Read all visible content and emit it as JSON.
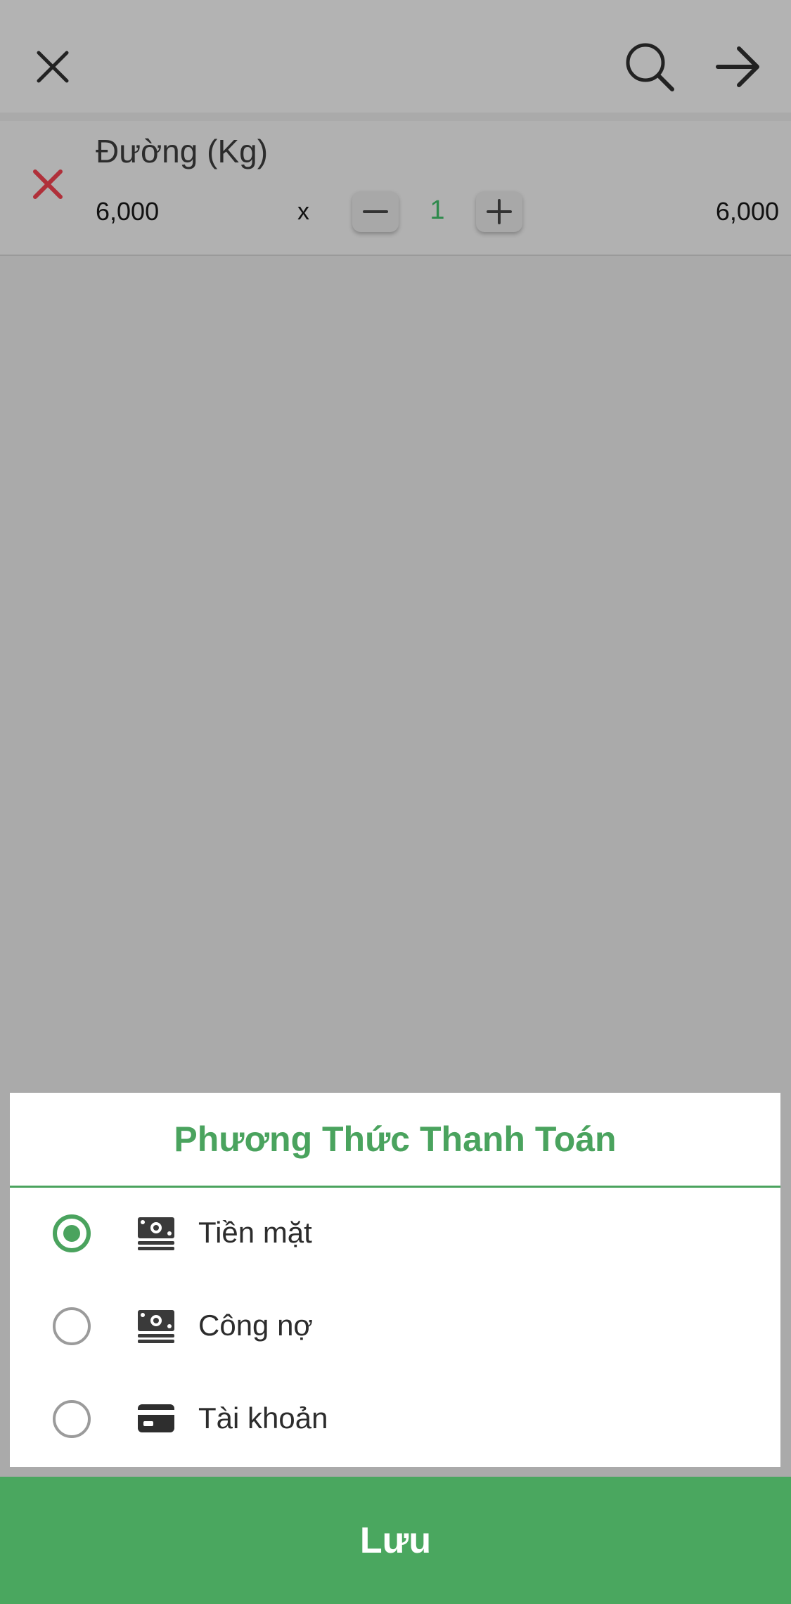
{
  "header": {
    "close_icon": "close-icon",
    "search_icon": "search-icon",
    "next_icon": "arrow-right-icon"
  },
  "cart": {
    "items": [
      {
        "name": "Đường (Kg)",
        "unit_price": "6,000",
        "multiply": "x",
        "quantity": "1",
        "total": "6,000"
      }
    ]
  },
  "payment_sheet": {
    "title": "Phương Thức Thanh Toán",
    "options": [
      {
        "label": "Tiền mặt",
        "icon": "cash-icon",
        "selected": true
      },
      {
        "label": "Công nợ",
        "icon": "cash-icon",
        "selected": false
      },
      {
        "label": "Tài khoản",
        "icon": "card-icon",
        "selected": false
      }
    ]
  },
  "footer": {
    "save_label": "Lưu"
  },
  "colors": {
    "accent": "#4aa35e",
    "remove": "#b0303a"
  }
}
